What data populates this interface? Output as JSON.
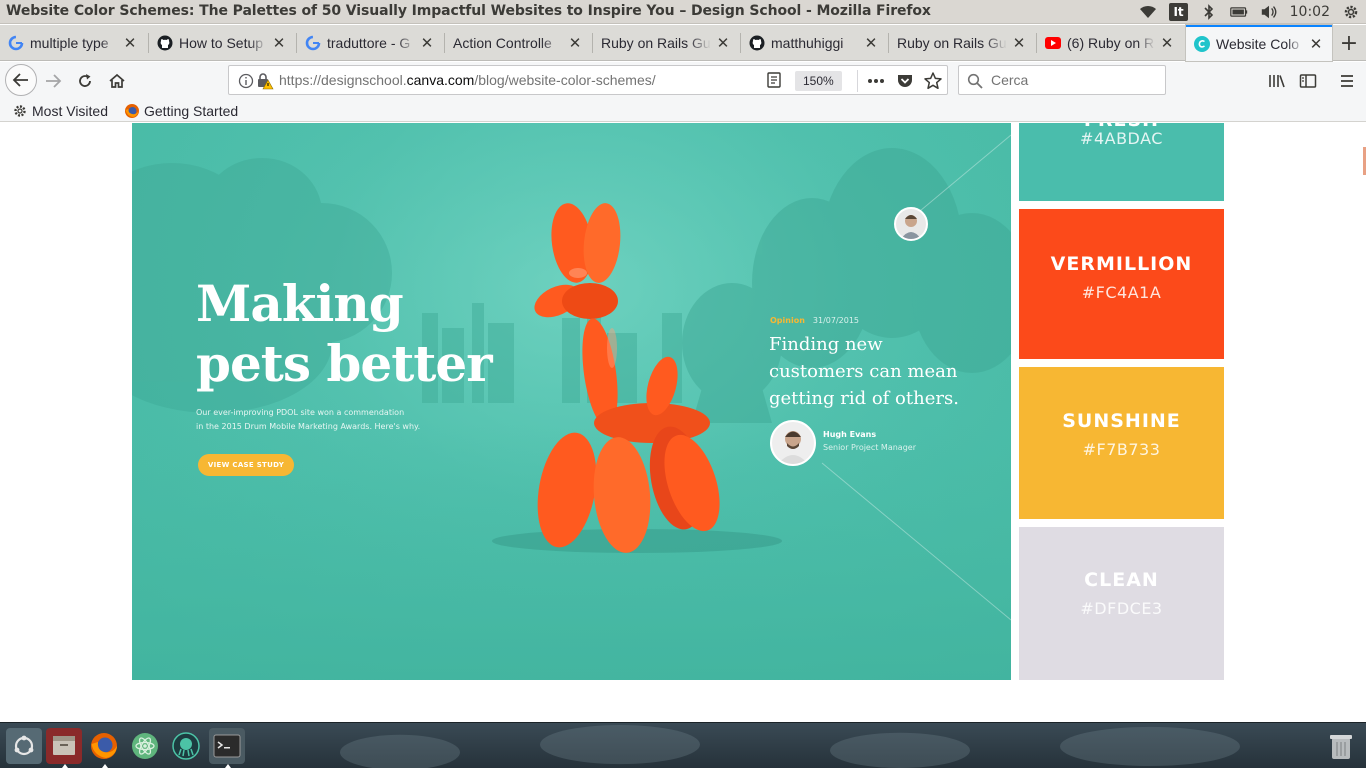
{
  "window": {
    "title": "Website Color Schemes: The Palettes of 50 Visually Impactful Websites to Inspire You – Design School - Mozilla Firefox"
  },
  "system_tray": {
    "keyboard_layout": "It",
    "clock": "10:02",
    "icons": [
      "wifi-icon",
      "keyboard-layout-badge",
      "bluetooth-icon",
      "battery-icon",
      "volume-icon",
      "settings-gear-icon"
    ]
  },
  "tabs": [
    {
      "label": "multiple type",
      "icon": "google-icon",
      "active": false
    },
    {
      "label": "How to Setup",
      "icon": "github-icon",
      "active": false
    },
    {
      "label": "traduttore - G",
      "icon": "google-icon",
      "active": false
    },
    {
      "label": "Action Controlle",
      "icon": "none",
      "active": false
    },
    {
      "label": "Ruby on Rails Gu",
      "icon": "none",
      "active": false
    },
    {
      "label": "matthuhiggi",
      "icon": "github-icon",
      "active": false
    },
    {
      "label": "Ruby on Rails Gu",
      "icon": "none",
      "active": false
    },
    {
      "label": "(6) Ruby on R",
      "icon": "youtube-icon",
      "active": false
    },
    {
      "label": "Website Colo",
      "icon": "canva-icon",
      "active": true
    }
  ],
  "navbar": {
    "url_prefix": "https://designschool.",
    "url_domain": "canva.com",
    "url_path": "/blog/website-color-schemes/",
    "zoom": "150%",
    "search_placeholder": "Cerca"
  },
  "bookmarks": [
    {
      "label": "Most Visited",
      "icon": "gear-icon"
    },
    {
      "label": "Getting Started",
      "icon": "firefox-icon"
    }
  ],
  "page": {
    "hero": {
      "headline_line1": "Making",
      "headline_line2": "pets better",
      "body_line1": "Our ever-improving PDOL site won a commendation",
      "body_line2": "in the 2015 Drum Mobile Marketing Awards. Here's why.",
      "button": "VIEW CASE STUDY",
      "quote_category": "Opinion",
      "quote_date": "31/07/2015",
      "quote": "Finding new customers can mean getting rid of others.",
      "author_name": "Hugh Evans",
      "author_role": "Senior Project Manager"
    },
    "swatches": [
      {
        "name": "FRESH",
        "hex": "#4ABDAC",
        "color": "#4ABDAC"
      },
      {
        "name": "VERMILLION",
        "hex": "#FC4A1A",
        "color": "#FC4A1A"
      },
      {
        "name": "SUNSHINE",
        "hex": "#F7B733",
        "color": "#F7B733"
      },
      {
        "name": "CLEAN",
        "hex": "#DFDCE3",
        "color": "#DFDCE3"
      }
    ]
  },
  "dock": {
    "items": [
      "ubuntu-launcher-icon",
      "files-icon",
      "firefox-icon",
      "atom-icon",
      "gitkraken-icon",
      "terminal-icon",
      "trash-icon"
    ]
  }
}
